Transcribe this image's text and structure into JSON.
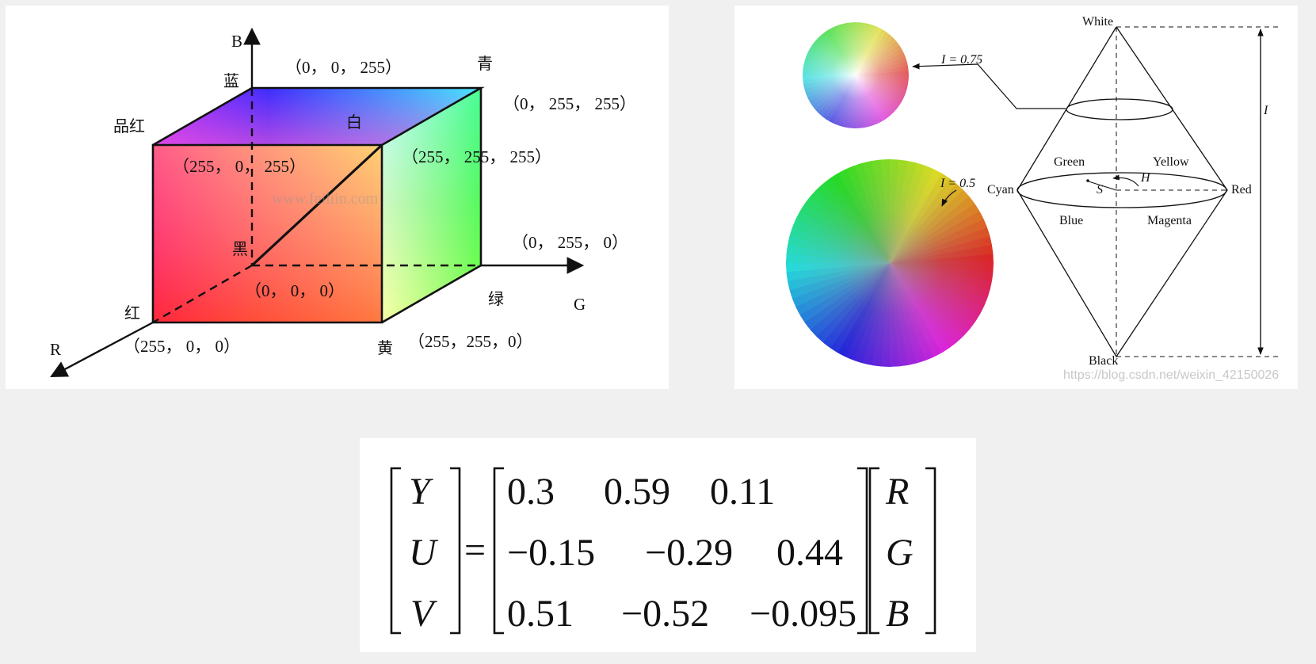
{
  "rgb_cube": {
    "axes": {
      "b": "B",
      "g": "G",
      "r": "R"
    },
    "corners": {
      "blue": {
        "name": "蓝",
        "coord": "（0， 0， 255）"
      },
      "cyan": {
        "name": "青",
        "coord": "（0， 255， 255）"
      },
      "magenta": {
        "name": "品红",
        "coord": "（255， 0， 255）"
      },
      "white": {
        "name": "白",
        "coord": "（255， 255， 255）"
      },
      "black": {
        "name": "黑",
        "coord": "（0， 0， 0）"
      },
      "green": {
        "name": "绿",
        "coord": "（0， 255， 0）"
      },
      "red": {
        "name": "红",
        "coord": "（255， 0， 0）"
      },
      "yellow": {
        "name": "黄",
        "coord": "（255，255，0）"
      }
    },
    "watermark": "www.feiliin.com"
  },
  "hsi_model": {
    "vertices": {
      "white": "White",
      "black": "Black",
      "cyan": "Cyan",
      "red": "Red"
    },
    "hues": {
      "green": "Green",
      "yellow": "Yellow",
      "blue": "Blue",
      "magenta": "Magenta"
    },
    "symbols": {
      "h": "H",
      "s": "S",
      "i": "I"
    },
    "intensity_labels": {
      "i075": "I = 0.75",
      "i05": "I = 0.5"
    },
    "watermark": "https://blog.csdn.net/weixin_42150026"
  },
  "yuv_formula": {
    "lhs": [
      "Y",
      "U",
      "V"
    ],
    "equals": "=",
    "matrix": [
      [
        "0.3",
        "0.59",
        "0.11"
      ],
      [
        "−0.15",
        "−0.29",
        "0.44"
      ],
      [
        "0.51",
        "−0.52",
        "−0.095"
      ]
    ],
    "rhs": [
      "R",
      "G",
      "B"
    ]
  }
}
